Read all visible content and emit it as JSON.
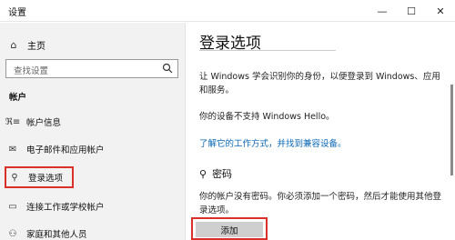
{
  "window": {
    "title": "设置"
  },
  "sidebar": {
    "home_label": "主页",
    "search_placeholder": "查找设置",
    "section_label": "帐户",
    "items": [
      {
        "label": "帐户信息",
        "icon": "person-card-icon"
      },
      {
        "label": "电子邮件和应用帐户",
        "icon": "mail-icon"
      },
      {
        "label": "登录选项",
        "icon": "key-icon",
        "selected": true
      },
      {
        "label": "连接工作或学校帐户",
        "icon": "briefcase-icon"
      },
      {
        "label": "家庭和其他人员",
        "icon": "people-icon"
      }
    ]
  },
  "main": {
    "title": "登录选项",
    "hello_desc": "让 Windows 学会识别你的身份，以便登录到 Windows、应用和服务。",
    "hello_unsupported": "你的设备不支持 Windows Hello。",
    "hello_link": "了解它的工作方式，并找到兼容设备。",
    "password_title": "密码",
    "password_desc": "你的帐户没有密码。你必须添加一个密码，然后才能使用其他登录选项。",
    "add_button": "添加"
  },
  "colors": {
    "highlight": "#d9302a",
    "link": "#0a67b6",
    "sidebar_bg": "#f2f2f2"
  }
}
